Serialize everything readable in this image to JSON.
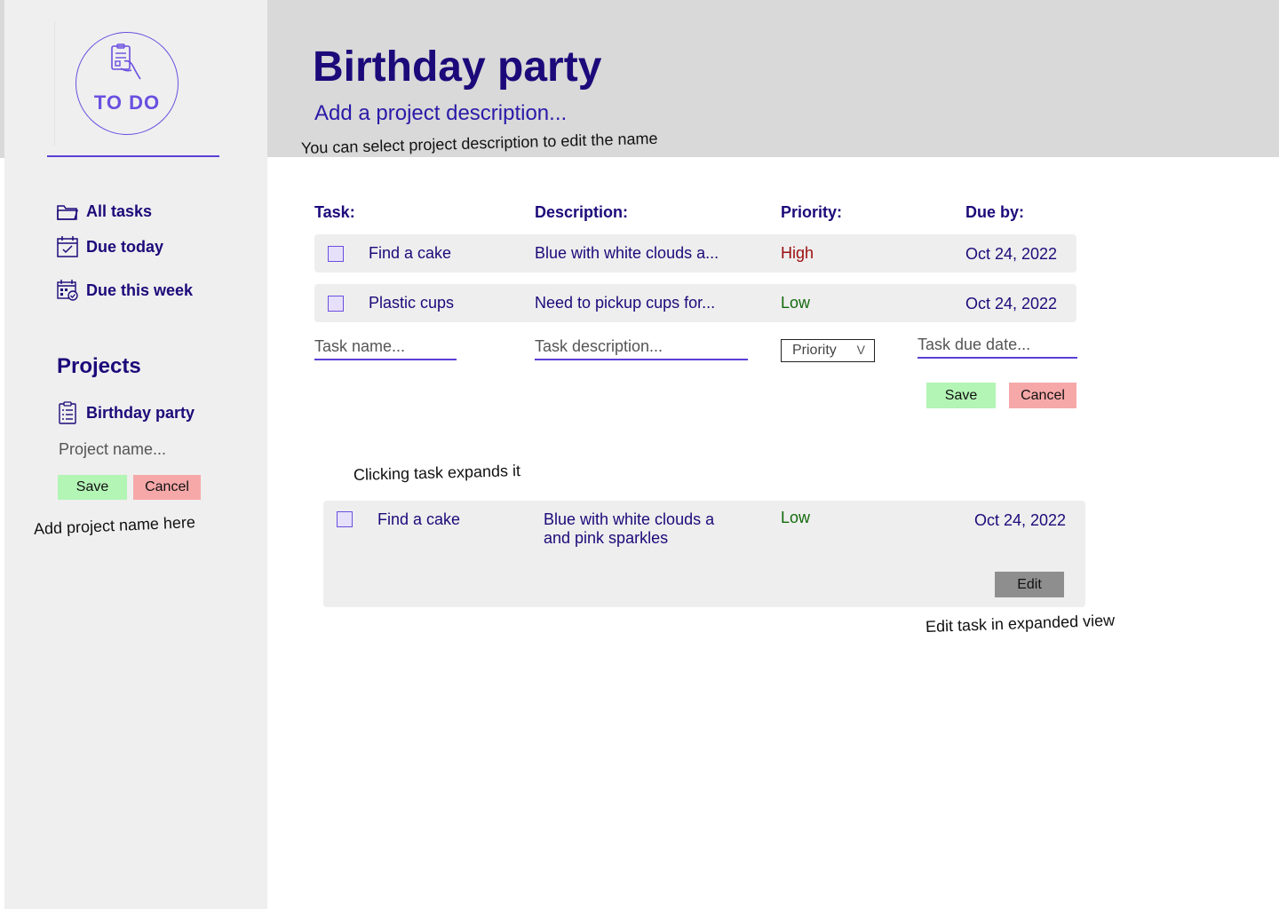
{
  "logo": {
    "text": "TO DO",
    "icon": "hand-holding-clipboard-icon"
  },
  "sidebar": {
    "nav": [
      {
        "label": "All tasks",
        "icon": "folder-icon"
      },
      {
        "label": "Due today",
        "icon": "calendar-check-icon"
      },
      {
        "label": "Due this week",
        "icon": "calendar-week-icon"
      }
    ],
    "projects_heading": "Projects",
    "projects": [
      {
        "label": "Birthday party",
        "icon": "clipboard-list-icon"
      }
    ],
    "new_project": {
      "placeholder": "Project name...",
      "save_label": "Save",
      "cancel_label": "Cancel"
    }
  },
  "notes": {
    "description_hint": "You can select project description to edit the name",
    "project_hint": "Add project name here",
    "expand_hint": "Clicking task expands it",
    "edit_hint": "Edit task in expanded view"
  },
  "header": {
    "title": "Birthday party",
    "description": "Add a project description..."
  },
  "table": {
    "columns": [
      "Task:",
      "Description:",
      "Priority:",
      "Due by:"
    ],
    "rows": [
      {
        "task": "Find a cake",
        "description": "Blue with white clouds a...",
        "priority": "High",
        "due": "Oct 24, 2022"
      },
      {
        "task": "Plastic cups",
        "description": "Need to pickup cups for...",
        "priority": "Low",
        "due": "Oct 24, 2022"
      }
    ]
  },
  "new_task": {
    "name_placeholder": "Task name...",
    "description_placeholder": "Task description...",
    "priority_placeholder": "Priority",
    "priority_chevron": "V",
    "due_placeholder": "Task due date...",
    "save_label": "Save",
    "cancel_label": "Cancel"
  },
  "expanded_task": {
    "task": "Find a cake",
    "description_line1": "Blue with white clouds a",
    "description_line2": "and pink sparkles",
    "priority": "Low",
    "due": "Oct 24, 2022",
    "edit_label": "Edit"
  },
  "colors": {
    "accent": "#5b3fd6",
    "text_primary": "#1c0a7a",
    "priority_high": "#9b0e0e",
    "priority_low": "#136a0c",
    "save": "#b3f5b5",
    "cancel": "#f6a8a8",
    "edit": "#8e8e8e"
  }
}
